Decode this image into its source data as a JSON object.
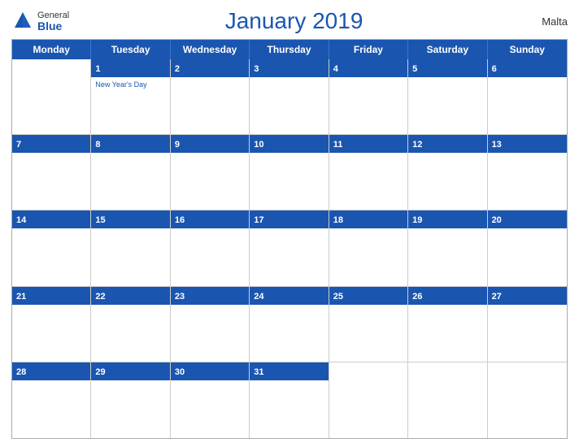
{
  "header": {
    "logo_general": "General",
    "logo_blue": "Blue",
    "title": "January 2019",
    "country": "Malta"
  },
  "days_of_week": [
    "Monday",
    "Tuesday",
    "Wednesday",
    "Thursday",
    "Friday",
    "Saturday",
    "Sunday"
  ],
  "weeks": [
    [
      {
        "num": "",
        "holiday": ""
      },
      {
        "num": "1",
        "holiday": "New Year's Day"
      },
      {
        "num": "2",
        "holiday": ""
      },
      {
        "num": "3",
        "holiday": ""
      },
      {
        "num": "4",
        "holiday": ""
      },
      {
        "num": "5",
        "holiday": ""
      },
      {
        "num": "6",
        "holiday": ""
      }
    ],
    [
      {
        "num": "7",
        "holiday": ""
      },
      {
        "num": "8",
        "holiday": ""
      },
      {
        "num": "9",
        "holiday": ""
      },
      {
        "num": "10",
        "holiday": ""
      },
      {
        "num": "11",
        "holiday": ""
      },
      {
        "num": "12",
        "holiday": ""
      },
      {
        "num": "13",
        "holiday": ""
      }
    ],
    [
      {
        "num": "14",
        "holiday": ""
      },
      {
        "num": "15",
        "holiday": ""
      },
      {
        "num": "16",
        "holiday": ""
      },
      {
        "num": "17",
        "holiday": ""
      },
      {
        "num": "18",
        "holiday": ""
      },
      {
        "num": "19",
        "holiday": ""
      },
      {
        "num": "20",
        "holiday": ""
      }
    ],
    [
      {
        "num": "21",
        "holiday": ""
      },
      {
        "num": "22",
        "holiday": ""
      },
      {
        "num": "23",
        "holiday": ""
      },
      {
        "num": "24",
        "holiday": ""
      },
      {
        "num": "25",
        "holiday": ""
      },
      {
        "num": "26",
        "holiday": ""
      },
      {
        "num": "27",
        "holiday": ""
      }
    ],
    [
      {
        "num": "28",
        "holiday": ""
      },
      {
        "num": "29",
        "holiday": ""
      },
      {
        "num": "30",
        "holiday": ""
      },
      {
        "num": "31",
        "holiday": ""
      },
      {
        "num": "",
        "holiday": ""
      },
      {
        "num": "",
        "holiday": ""
      },
      {
        "num": "",
        "holiday": ""
      }
    ]
  ]
}
